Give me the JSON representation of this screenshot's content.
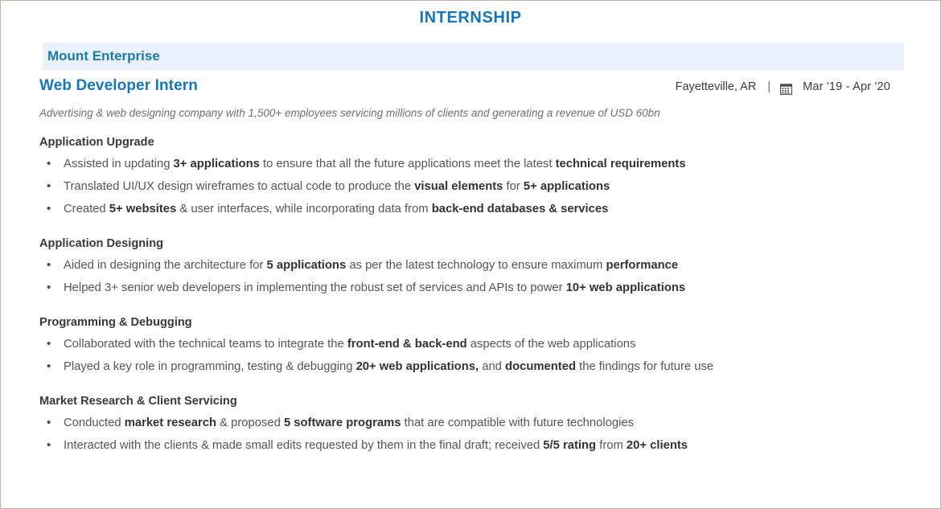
{
  "document": {
    "section_title": "INTERNSHIP"
  },
  "experience": {
    "company": "Mount Enterprise",
    "role": "Web Developer Intern",
    "location": "Fayetteville, AR",
    "separator": "|",
    "calendar_icon": "calendar-icon",
    "dates": "Mar '19 -  Apr '20",
    "summary": "Advertising & web designing company with 1,500+ employees servicing millions of clients and generating a revenue of USD 60bn",
    "blocks": [
      {
        "heading": "Application Upgrade",
        "bullets": [
          [
            {
              "t": "Assisted in updating ",
              "b": false
            },
            {
              "t": "3+ applications",
              "b": true
            },
            {
              "t": " to ensure that all the future applications meet the latest ",
              "b": false
            },
            {
              "t": "technical requirements",
              "b": true
            }
          ],
          [
            {
              "t": "Translated UI/UX design wireframes to actual code to produce the ",
              "b": false
            },
            {
              "t": "visual elements",
              "b": true
            },
            {
              "t": " for ",
              "b": false
            },
            {
              "t": "5+ applications",
              "b": true
            }
          ],
          [
            {
              "t": "Created ",
              "b": false
            },
            {
              "t": "5+ websites",
              "b": true
            },
            {
              "t": " & user interfaces, while incorporating data from ",
              "b": false
            },
            {
              "t": "back-end databases & services",
              "b": true
            }
          ]
        ]
      },
      {
        "heading": "Application Designing",
        "bullets": [
          [
            {
              "t": "Aided in designing the architecture for ",
              "b": false
            },
            {
              "t": "5 applications",
              "b": true
            },
            {
              "t": " as per the latest technology to ensure maximum ",
              "b": false
            },
            {
              "t": "performance",
              "b": true
            }
          ],
          [
            {
              "t": "Helped 3+ senior web developers in implementing the robust set of services and APIs to power ",
              "b": false
            },
            {
              "t": "10+ web applications",
              "b": true
            }
          ]
        ]
      },
      {
        "heading": "Programming & Debugging",
        "bullets": [
          [
            {
              "t": "Collaborated with the technical teams to integrate the ",
              "b": false
            },
            {
              "t": "front-end & back-end",
              "b": true
            },
            {
              "t": " aspects of the web applications",
              "b": false
            }
          ],
          [
            {
              "t": "Played a key role in programming, testing & debugging ",
              "b": false
            },
            {
              "t": "20+ web applications,",
              "b": true
            },
            {
              "t": " and ",
              "b": false
            },
            {
              "t": "documented",
              "b": true
            },
            {
              "t": " the findings for future use",
              "b": false
            }
          ]
        ]
      },
      {
        "heading": "Market Research & Client Servicing",
        "bullets": [
          [
            {
              "t": "Conducted ",
              "b": false
            },
            {
              "t": "market research",
              "b": true
            },
            {
              "t": " & proposed ",
              "b": false
            },
            {
              "t": "5 software programs",
              "b": true
            },
            {
              "t": " that are compatible with future technologies",
              "b": false
            }
          ],
          [
            {
              "t": "Interacted with the clients & made small edits requested by them in the final draft; received ",
              "b": false
            },
            {
              "t": "5/5 rating",
              "b": true
            },
            {
              "t": " from ",
              "b": false
            },
            {
              "t": "20+ clients",
              "b": true
            }
          ]
        ]
      }
    ]
  },
  "colors": {
    "accent_blue": "#1277bd",
    "band_blue": "#e9f2fb",
    "body_text": "#555555"
  }
}
